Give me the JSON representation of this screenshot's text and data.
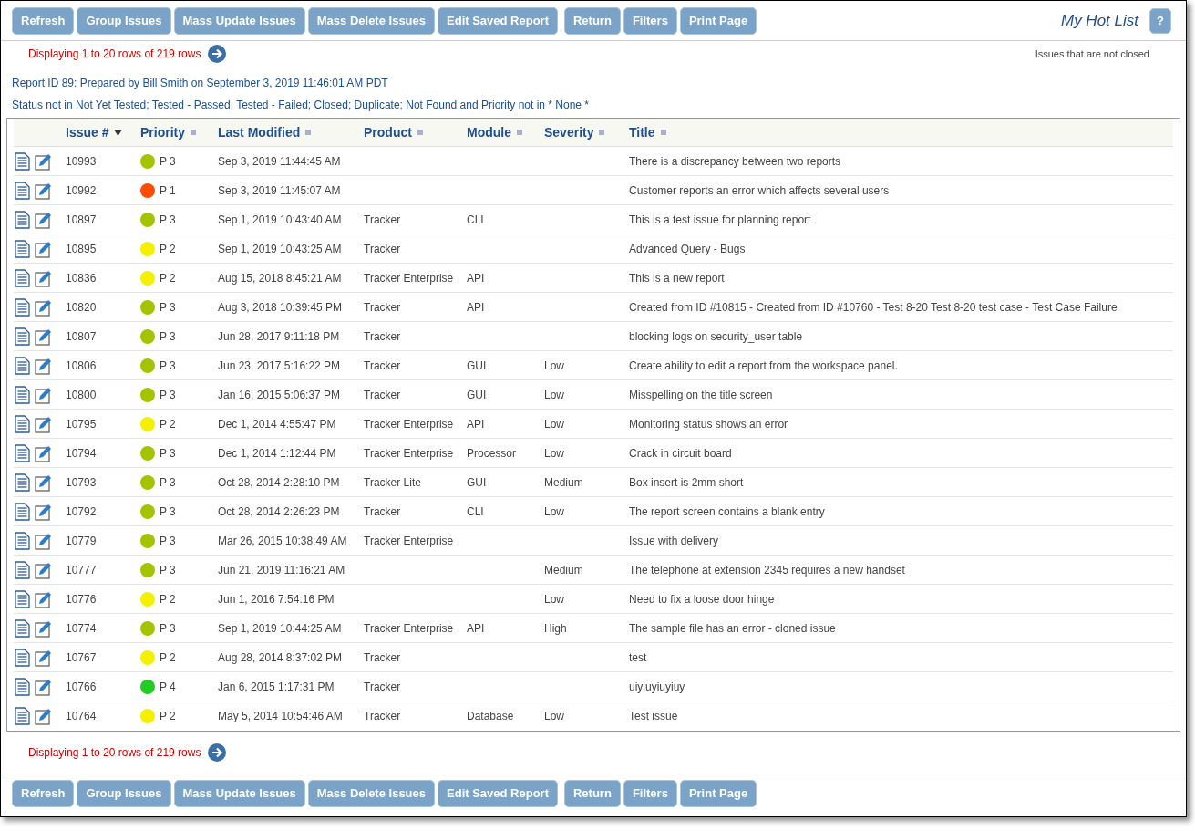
{
  "toolbar": {
    "buttons": [
      "Refresh",
      "Group Issues",
      "Mass Update Issues",
      "Mass Delete Issues",
      "Edit Saved Report",
      "Return",
      "Filters",
      "Print Page"
    ],
    "title": "My Hot List",
    "help": "?"
  },
  "pager_top": "Displaying 1 to 20 rows of 219 rows",
  "filter_name": "Issues that are not closed",
  "report_info": "Report ID 89: Prepared by Bill Smith on September 3, 2019 11:46:01 AM PDT",
  "criteria": "Status not in Not Yet Tested; Tested - Passed; Tested - Failed; Closed; Duplicate; Not Found and Priority not in * None *",
  "table": {
    "columns": [
      {
        "label": "Issue #",
        "sorted": true
      },
      {
        "label": "Priority",
        "sorted": false
      },
      {
        "label": "Last Modified",
        "sorted": false
      },
      {
        "label": "Product",
        "sorted": false
      },
      {
        "label": "Module",
        "sorted": false
      },
      {
        "label": "Severity",
        "sorted": false
      },
      {
        "label": "Title",
        "sorted": false
      }
    ],
    "rows": [
      {
        "issue": "10993",
        "priority": "P 3",
        "color": "#a4c400",
        "modified": "Sep 3, 2019 11:44:45 AM",
        "title": "There is a discrepancy between two reports"
      },
      {
        "issue": "10992",
        "priority": "P 1",
        "color": "#ff4c00",
        "modified": "Sep 3, 2019 11:45:07 AM",
        "title": "Customer reports an error which affects several users"
      },
      {
        "issue": "10897",
        "priority": "P 3",
        "color": "#a4c400",
        "modified": "Sep 1, 2019 10:43:40 AM",
        "product": "Tracker",
        "module": "CLI",
        "title": "This is a test issue for planning report"
      },
      {
        "issue": "10895",
        "priority": "P 2",
        "color": "#f5f000",
        "modified": "Sep 1, 2019 10:43:25 AM",
        "product": "Tracker",
        "title": "Advanced Query - Bugs"
      },
      {
        "issue": "10836",
        "priority": "P 2",
        "color": "#f5f000",
        "modified": "Aug 15, 2018 8:45:21 AM",
        "product": "Tracker Enterprise",
        "module": "API",
        "title": "This is a new report"
      },
      {
        "issue": "10820",
        "priority": "P 3",
        "color": "#a4c400",
        "modified": "Aug 3, 2018 10:39:45 PM",
        "product": "Tracker",
        "module": "API",
        "title": "Created from ID #10815 - Created from ID #10760 - Test 8-20 Test 8-20 test case - Test Case Failure"
      },
      {
        "issue": "10807",
        "priority": "P 3",
        "color": "#a4c400",
        "modified": "Jun 28, 2017 9:11:18 PM",
        "product": "Tracker",
        "title": "blocking logs on security_user table"
      },
      {
        "issue": "10806",
        "priority": "P 3",
        "color": "#a4c400",
        "modified": "Jun 23, 2017 5:16:22 PM",
        "product": "Tracker",
        "module": "GUI",
        "severity": "Low",
        "title": "Create ability to edit a report from the workspace panel."
      },
      {
        "issue": "10800",
        "priority": "P 3",
        "color": "#a4c400",
        "modified": "Jan 16, 2015 5:06:37 PM",
        "product": "Tracker",
        "module": "GUI",
        "severity": "Low",
        "title": "Misspelling on the title screen"
      },
      {
        "issue": "10795",
        "priority": "P 2",
        "color": "#f5f000",
        "modified": "Dec 1, 2014 4:55:47 PM",
        "product": "Tracker Enterprise",
        "module": "API",
        "severity": "Low",
        "title": "Monitoring status shows an error"
      },
      {
        "issue": "10794",
        "priority": "P 3",
        "color": "#a4c400",
        "modified": "Dec 1, 2014 1:12:44 PM",
        "product": "Tracker Enterprise",
        "module": "Processor",
        "severity": "Low",
        "title": "Crack in circuit board"
      },
      {
        "issue": "10793",
        "priority": "P 3",
        "color": "#a4c400",
        "modified": "Oct 28, 2014 2:28:10 PM",
        "product": "Tracker Lite",
        "module": "GUI",
        "severity": "Medium",
        "title": "Box insert is 2mm short"
      },
      {
        "issue": "10792",
        "priority": "P 3",
        "color": "#a4c400",
        "modified": "Oct 28, 2014 2:26:23 PM",
        "product": "Tracker",
        "module": "CLI",
        "severity": "Low",
        "title": "The report screen contains a blank entry"
      },
      {
        "issue": "10779",
        "priority": "P 3",
        "color": "#a4c400",
        "modified": "Mar 26, 2015 10:38:49 AM",
        "product": "Tracker Enterprise",
        "title": "Issue with delivery"
      },
      {
        "issue": "10777",
        "priority": "P 3",
        "color": "#a4c400",
        "modified": "Jun 21, 2019 11:16:21 AM",
        "severity": "Medium",
        "title": "The telephone at extension 2345 requires a new handset"
      },
      {
        "issue": "10776",
        "priority": "P 2",
        "color": "#f5f000",
        "modified": "Jun 1, 2016 7:54:16 PM",
        "severity": "Low",
        "title": "Need to fix a loose door hinge"
      },
      {
        "issue": "10774",
        "priority": "P 3",
        "color": "#a4c400",
        "modified": "Sep 1, 2019 10:44:25 AM",
        "product": "Tracker Enterprise",
        "module": "API",
        "severity": "High",
        "title": "The sample file has an error - cloned issue"
      },
      {
        "issue": "10767",
        "priority": "P 2",
        "color": "#f5f000",
        "modified": "Aug 28, 2014 8:37:02 PM",
        "product": "Tracker",
        "title": "test"
      },
      {
        "issue": "10766",
        "priority": "P 4",
        "color": "#22cc22",
        "modified": "Jan 6, 2015 1:17:31 PM",
        "product": "Tracker",
        "title": "uiyiuyiuyiuy"
      },
      {
        "issue": "10764",
        "priority": "P 2",
        "color": "#f5f000",
        "modified": "May 5, 2014 10:54:46 AM",
        "product": "Tracker",
        "module": "Database",
        "severity": "Low",
        "title": "Test issue"
      }
    ]
  },
  "pager_bottom": "Displaying 1 to 20 rows of 219 rows",
  "bottom_buttons": [
    "Refresh",
    "Group Issues",
    "Mass Update Issues",
    "Mass Delete Issues",
    "Edit Saved Report",
    "Return",
    "Filters",
    "Print Page"
  ]
}
